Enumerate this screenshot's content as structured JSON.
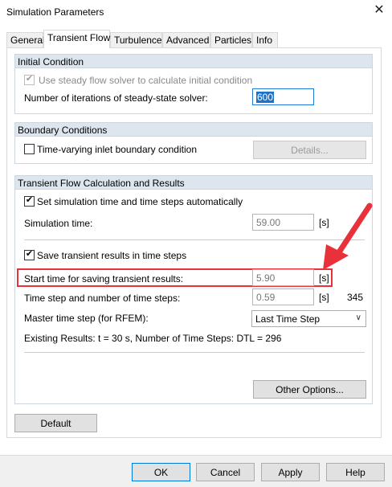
{
  "window": {
    "title": "Simulation Parameters",
    "close_icon": "close-icon"
  },
  "tabs": [
    {
      "label": "General"
    },
    {
      "label": "Transient Flow"
    },
    {
      "label": "Turbulence"
    },
    {
      "label": "Advanced"
    },
    {
      "label": "Particles"
    },
    {
      "label": "Info"
    }
  ],
  "initial_condition": {
    "title": "Initial Condition",
    "use_steady_label": "Use steady flow solver to calculate initial condition",
    "iterations_label": "Number of iterations of steady-state solver:",
    "iterations_value": "600"
  },
  "boundary_conditions": {
    "title": "Boundary Conditions",
    "time_varying_label": "Time-varying inlet boundary condition",
    "details_button": "Details..."
  },
  "transient": {
    "title": "Transient Flow Calculation and Results",
    "auto_time_label": "Set simulation time and time steps automatically",
    "sim_time_label": "Simulation time:",
    "sim_time_value": "59.00",
    "sim_time_unit": "[s]",
    "save_results_label": "Save transient results in time steps",
    "start_time_label": "Start time for saving transient results:",
    "start_time_value": "5.90",
    "start_time_unit": "[s]",
    "time_step_label": "Time step and number of time steps:",
    "time_step_value": "0.59",
    "time_step_unit": "[s]",
    "num_time_steps": "345",
    "master_step_label": "Master time step (for RFEM):",
    "master_step_value": "Last Time Step",
    "existing_results": "Existing Results: t = 30 s, Number of Time Steps: DTL = 296",
    "other_options_button": "Other Options..."
  },
  "default_button": "Default",
  "footer": {
    "ok": "OK",
    "cancel": "Cancel",
    "apply": "Apply",
    "help": "Help"
  },
  "colors": {
    "highlight": "#e8313a",
    "group_header": "#dde5ee",
    "accent": "#1e73c9"
  }
}
